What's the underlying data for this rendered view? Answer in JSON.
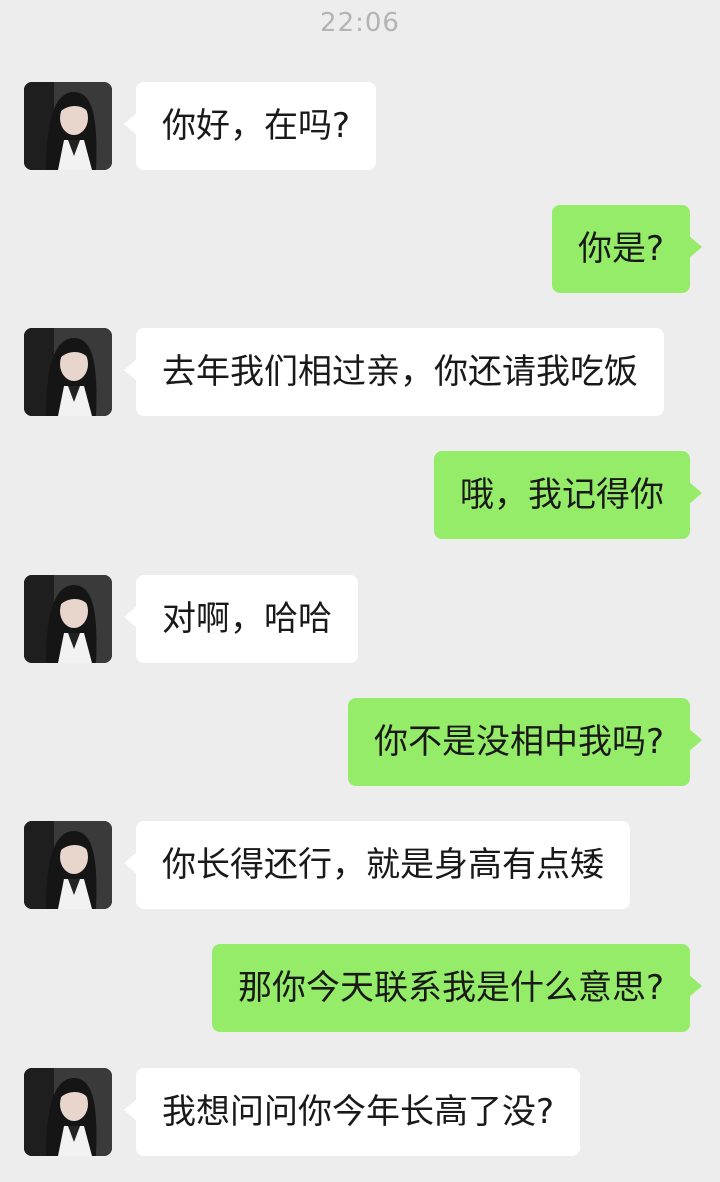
{
  "timestamp": "22:06",
  "messages": [
    {
      "side": "in",
      "text": "你好，在吗?"
    },
    {
      "side": "out",
      "text": "你是?"
    },
    {
      "side": "in",
      "text": "去年我们相过亲，你还请我吃饭"
    },
    {
      "side": "out",
      "text": "哦，我记得你"
    },
    {
      "side": "in",
      "text": "对啊，哈哈"
    },
    {
      "side": "out",
      "text": "你不是没相中我吗?"
    },
    {
      "side": "in",
      "text": "你长得还行，就是身高有点矮"
    },
    {
      "side": "out",
      "text": "那你今天联系我是什么意思?"
    },
    {
      "side": "in",
      "text": "我想问问你今年长高了没?"
    }
  ],
  "contact_avatar_icon": "contact-avatar-photo",
  "colors": {
    "background": "#ededed",
    "incoming_bubble": "#ffffff",
    "outgoing_bubble": "#95ec69"
  }
}
